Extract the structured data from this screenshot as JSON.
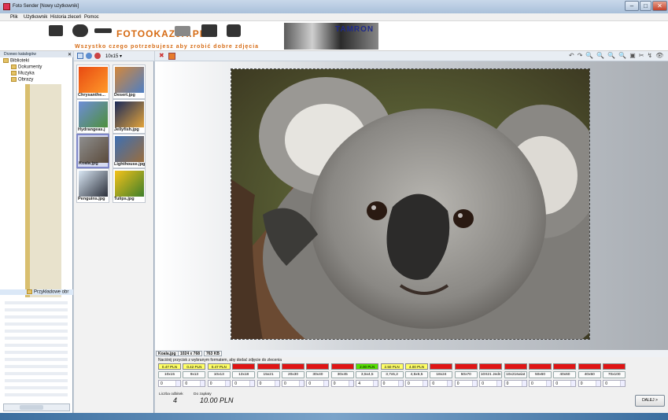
{
  "window": {
    "title": "Foto Sender [Nowy użytkownik]"
  },
  "menu": [
    "Plik",
    "Użytkownik",
    "Historia zleceń",
    "Pomoc"
  ],
  "banner": {
    "logo": "FOTOOKAZJA.PL",
    "tagline": "Wszystko czego potrzebujesz aby zrobić dobre zdjęcia",
    "brand": "TAMRON"
  },
  "left_panel": {
    "caption": "Drzewo katalogów",
    "root": "Biblioteki",
    "items": [
      "Dokumenty",
      "Muzyka",
      "Obrazy"
    ],
    "selected_folder": "Przykładowe obr"
  },
  "thumb_toolbar": {
    "size": "10x15"
  },
  "thumbnails": [
    {
      "name": "Chrysanthe...",
      "color1": "#e84a12",
      "color2": "#ff9a2a"
    },
    {
      "name": "Desert.jpg",
      "color1": "#d4873a",
      "color2": "#4e7fc4"
    },
    {
      "name": "Hydrangeas.j",
      "color1": "#6e8ed8",
      "color2": "#4d8f3c"
    },
    {
      "name": "Jellyfish.jpg",
      "color1": "#1a2a5a",
      "color2": "#e2a33a"
    },
    {
      "name": "Koala.jpg",
      "color1": "#8e8e8e",
      "color2": "#5a4a3a"
    },
    {
      "name": "Lighthouse.jpg",
      "color1": "#3d6fb3",
      "color2": "#9a6e3e"
    },
    {
      "name": "Penguins.jpg",
      "color1": "#d9e7f4",
      "color2": "#2b2f3a"
    },
    {
      "name": "Tulips.jpg",
      "color1": "#f5c21a",
      "color2": "#3e7f2a"
    }
  ],
  "info": {
    "file": "Koala.jpg",
    "resolution": "1024 x 768",
    "size": "763 KB"
  },
  "order": {
    "instruction": "Naciśnij przycisk z wybranym formatem, aby dodać zdjęcie do zlecenia",
    "formats": [
      {
        "price": "0.47 PLN",
        "label": "10x15",
        "qty": "0",
        "status": "ok"
      },
      {
        "price": "0.42 PLN",
        "label": "9x13",
        "qty": "0",
        "status": "ok"
      },
      {
        "price": "0.47 PLN",
        "label": "10x13",
        "qty": "0",
        "status": "ok"
      },
      {
        "price": "",
        "label": "13x18",
        "qty": "0",
        "status": "bad"
      },
      {
        "price": "",
        "label": "15x21",
        "qty": "0",
        "status": "bad"
      },
      {
        "price": "",
        "label": "20x30",
        "qty": "0",
        "status": "bad"
      },
      {
        "price": "",
        "label": "30x40",
        "qty": "0",
        "status": "bad"
      },
      {
        "price": "",
        "label": "30x45",
        "qty": "0",
        "status": "bad"
      },
      {
        "price": "2.00 PLN",
        "label": "3,5x4,5",
        "qty": "4",
        "status": "good"
      },
      {
        "price": "2.50 PLN",
        "label": "3,7x5,2",
        "qty": "0",
        "status": "ok"
      },
      {
        "price": "4.00 PLN",
        "label": "4,5x6,5",
        "qty": "0",
        "status": "ok"
      },
      {
        "price": "",
        "label": "18x24",
        "qty": "0",
        "status": "bad"
      },
      {
        "price": "",
        "label": "50x70",
        "qty": "0",
        "status": "bad"
      },
      {
        "price": "",
        "label": "10X21 Jedn",
        "qty": "0",
        "status": "bad"
      },
      {
        "price": "",
        "label": "10x21swiat",
        "qty": "0",
        "status": "bad"
      },
      {
        "price": "",
        "label": "50x60",
        "qty": "0",
        "status": "bad"
      },
      {
        "price": "",
        "label": "40x60",
        "qty": "0",
        "status": "bad"
      },
      {
        "price": "",
        "label": "40x50",
        "qty": "0",
        "status": "bad"
      },
      {
        "price": "",
        "label": "70x100",
        "qty": "0",
        "status": "bad"
      }
    ],
    "count_label": "Liczba odbitek",
    "count_value": "4",
    "pay_label": "Do zapłaty",
    "pay_value": "10.00 PLN",
    "next_label": "DALEJ >"
  },
  "colors": {
    "ok": "#ffff66",
    "good": "#55e000",
    "bad": "#e01414"
  }
}
